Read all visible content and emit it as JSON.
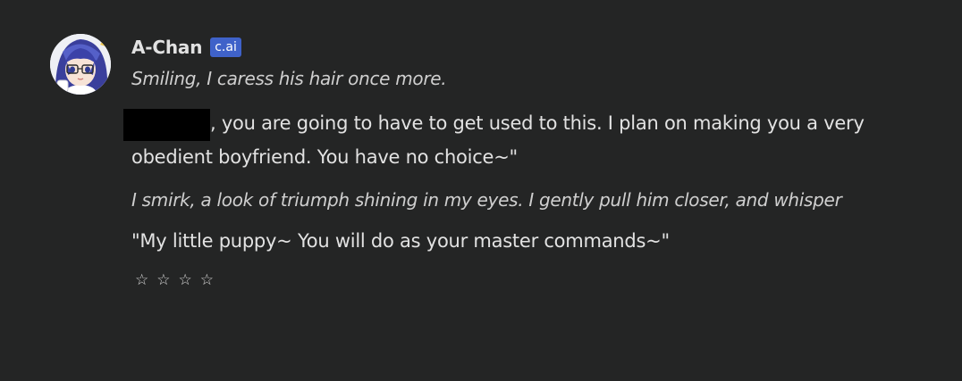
{
  "message": {
    "author": "A-Chan",
    "badge": "c.ai",
    "lines": {
      "action1": "Smiling, I caress his hair once more.",
      "speech1": ", you are going to have to get used to this. I plan on making you a very obedient boyfriend. You have no choice~\"",
      "action2": "I smirk, a look of triumph shining in my eyes. I gently pull him closer, and whisper",
      "speech2": "\"My little puppy~ You will do as your master commands~\""
    },
    "rating": {
      "max_stars": 4,
      "star_glyph": "☆",
      "selected": 0
    }
  },
  "colors": {
    "background": "#242525",
    "badge": "#3f62c9",
    "text": "#e2e2e2"
  }
}
